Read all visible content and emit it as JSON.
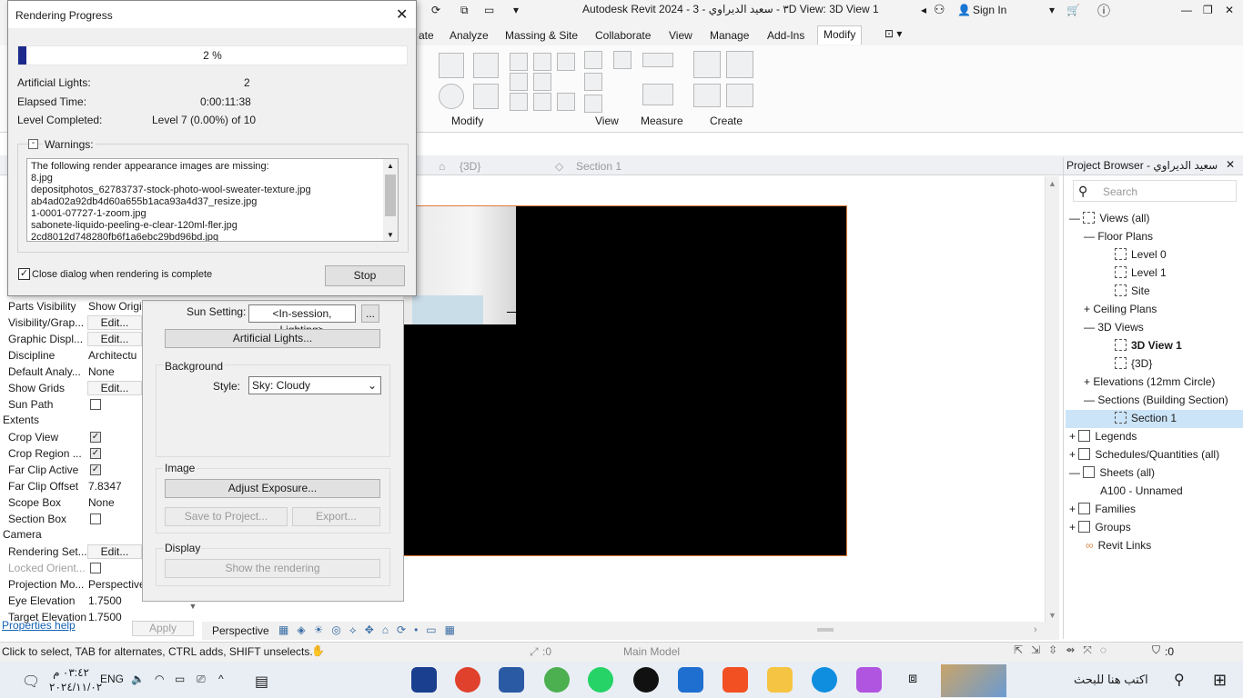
{
  "titlebar": {
    "title": "Autodesk Revit 2024 - ٣ - سعيد الديراوي - 3D View: 3D View 1",
    "sign_in": "Sign In"
  },
  "ribbon": {
    "tabs": [
      "ate",
      "Analyze",
      "Massing & Site",
      "Collaborate",
      "View",
      "Manage",
      "Add-Ins",
      "Modify"
    ],
    "active": "Modify",
    "groups": [
      "Modify",
      "View",
      "Measure",
      "Create"
    ]
  },
  "view_tabs": {
    "tab1": "{3D}",
    "tab2": "Section 1"
  },
  "render_dialog": {
    "title": "Rendering Progress",
    "progress_text": "2 %",
    "progress_pct": 2,
    "artificial_lights_label": "Artificial Lights:",
    "artificial_lights_value": "2",
    "elapsed_label": "Elapsed Time:",
    "elapsed_value": "0:00:11:38",
    "level_label": "Level Completed:",
    "level_value": "Level 7 (0.00%) of 10",
    "warnings_label": "Warnings:",
    "warnings": [
      "The following render appearance images are missing:",
      "8.jpg",
      "depositphotos_62783737-stock-photo-wool-sweater-texture.jpg",
      "ab4ad02a92db4d60a655b1aca93a4d37_resize.jpg",
      "1-0001-07727-1-zoom.jpg",
      "sabonete-liquido-peeling-e-clear-120ml-fler.jpg",
      "2cd8012d748280fb6f1a6ebc29bd96bd.jpg"
    ],
    "close_check_label": "Close dialog when rendering is complete",
    "stop_label": "Stop"
  },
  "render_settings": {
    "sun_label": "Sun Setting:",
    "sun_value": "<In-session, Lighting>",
    "sun_more": "...",
    "artificial_lights_button": "Artificial Lights...",
    "background_title": "Background",
    "style_label": "Style:",
    "style_value": "Sky: Cloudy",
    "image_title": "Image",
    "adjust_exposure": "Adjust Exposure...",
    "save_to_project": "Save to Project...",
    "export": "Export...",
    "display_title": "Display",
    "show_rendering": "Show the rendering"
  },
  "properties": {
    "rows": [
      {
        "k": "Parts Visibility",
        "v": "Show Origi"
      },
      {
        "k": "Visibility/Grap...",
        "b": "Edit..."
      },
      {
        "k": "Graphic Displ...",
        "b": "Edit..."
      },
      {
        "k": "Discipline",
        "v": "Architectu"
      },
      {
        "k": "Default Analy...",
        "v": "None"
      },
      {
        "k": "Show Grids",
        "b": "Edit..."
      },
      {
        "k": "Sun Path",
        "c": false
      }
    ],
    "extents": "Extents",
    "extent_rows": [
      {
        "k": "Crop View",
        "c": true
      },
      {
        "k": "Crop Region ...",
        "c": true
      },
      {
        "k": "Far Clip Active",
        "c": true
      },
      {
        "k": "Far Clip Offset",
        "v": "7.8347"
      },
      {
        "k": "Scope Box",
        "v": "None"
      },
      {
        "k": "Section Box",
        "c": false
      }
    ],
    "camera": "Camera",
    "camera_rows": [
      {
        "k": "Rendering Set...",
        "b": "Edit..."
      },
      {
        "k": "Locked Orient...",
        "c": false
      },
      {
        "k": "Projection Mo...",
        "v": "Perspective"
      },
      {
        "k": "Eye Elevation",
        "v": "1.7500"
      },
      {
        "k": "Target Elevation",
        "v": "1.7500"
      }
    ],
    "help": "Properties help",
    "apply": "Apply"
  },
  "view_bar": {
    "mode": "Perspective"
  },
  "project_browser": {
    "title": "Project Browser - سعيد الديراوي",
    "search_placeholder": "Search",
    "items": [
      "Views (all)",
      "Floor Plans",
      "Level 0",
      "Level 1",
      "Site",
      "Ceiling Plans",
      "3D Views",
      "3D View 1",
      "{3D}",
      "Elevations (12mm Circle)",
      "Sections (Building Section)",
      "Section 1",
      "Legends",
      "Schedules/Quantities (all)",
      "Sheets (all)",
      "A100 - Unnamed",
      "Families",
      "Groups",
      "Revit Links"
    ]
  },
  "status": {
    "hint": "Click to select, TAB for alternates, CTRL adds, SHIFT unselects.",
    "count": ":0",
    "model": "Main Model",
    "filter": ":0"
  },
  "taskbar": {
    "time": "٠٣:٤٢ م",
    "date": "٢٠٢٤/١١/٠٢",
    "lang": "ENG",
    "search_text": "اكتب هنا للبحث"
  },
  "colors": {
    "progress": "#1c2a8c",
    "selection": "#cce4f7"
  }
}
